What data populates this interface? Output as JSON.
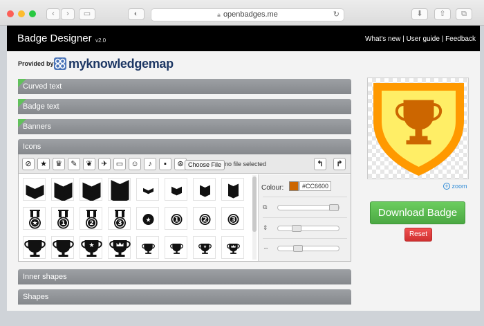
{
  "browser": {
    "url": "openbadges.me"
  },
  "app": {
    "title": "Badge Designer",
    "version": "v2.0",
    "links": [
      "What's new",
      "User guide",
      "Feedback"
    ],
    "separator": " | "
  },
  "provider": {
    "label": "Provided by",
    "name": "myknowledgemap"
  },
  "sections": {
    "curved_text": "Curved text",
    "badge_text": "Badge text",
    "banners": "Banners",
    "icons": "Icons",
    "inner_shapes": "Inner shapes",
    "shapes": "Shapes"
  },
  "icons_panel": {
    "choose_file": "Choose File",
    "no_file": "no file selected",
    "colour_label": "Colour:",
    "colour_value": "#CC6600",
    "toolbar_icons": [
      "ban-icon",
      "star-icon",
      "trophy-icon",
      "pencil-icon",
      "leaf-icon",
      "plane-icon",
      "laptop-icon",
      "person-icon",
      "microphone-icon",
      "briefcase-icon",
      "lifebuoy-icon"
    ],
    "grid_rows": [
      [
        "chevrons-2",
        "chevrons-3",
        "chevrons-3",
        "chevrons-4",
        "chevrons-small-1",
        "chevrons-small-2",
        "chevrons-small-3",
        "chevrons-small-4"
      ],
      [
        "medal-star",
        "medal-1",
        "medal-2",
        "medal-3",
        "coin-star",
        "coin-1",
        "coin-2",
        "coin-3"
      ],
      [
        "trophy-plain",
        "trophy-plain",
        "trophy-star",
        "trophy-crown",
        "trophy-small",
        "trophy-small",
        "trophy-small-star",
        "trophy-small-crown"
      ]
    ],
    "medal_numbers": [
      "1",
      "2",
      "3"
    ]
  },
  "preview": {
    "zoom_label": "zoom",
    "shield_outer": "#ff9900",
    "shield_inner": "#ffee66",
    "trophy_colour": "#cc6600"
  },
  "buttons": {
    "download": "Download Badge",
    "reset": "Reset"
  }
}
